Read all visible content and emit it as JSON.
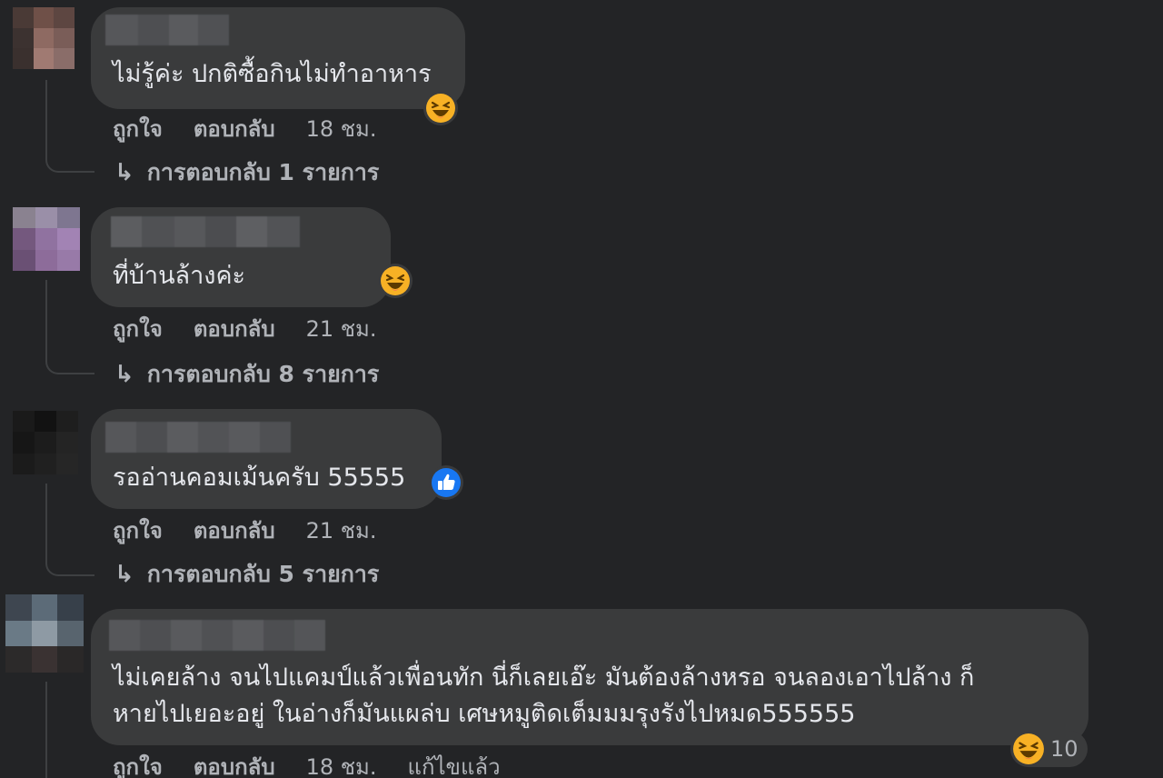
{
  "comments": [
    {
      "text_lines": [
        "ไม่รู้ค่ะ ปกติซื้อกินไม่ทำอาหาร"
      ],
      "reaction": "haha",
      "actions": {
        "like": "ถูกใจ",
        "reply": "ตอบกลับ",
        "time": "18 ชม."
      },
      "replies_label": "การตอบกลับ 1 รายการ"
    },
    {
      "text_lines": [
        "ที่บ้านล้างค่ะ"
      ],
      "reaction": "haha",
      "actions": {
        "like": "ถูกใจ",
        "reply": "ตอบกลับ",
        "time": "21 ชม."
      },
      "replies_label": "การตอบกลับ 8 รายการ"
    },
    {
      "text_lines": [
        "รออ่านคอมเม้นครับ 55555"
      ],
      "reaction": "like",
      "actions": {
        "like": "ถูกใจ",
        "reply": "ตอบกลับ",
        "time": "21 ชม."
      },
      "replies_label": "การตอบกลับ 5 รายการ"
    },
    {
      "text_lines": [
        "ไม่เคยล้าง จนไปแคมป์แล้วเพื่อนทัก นี่ก็เลยเอ๊ะ มันต้องล้างหรอ จนลองเอาไปล้าง ก็",
        "หายไปเยอะอยู่ ในอ่างก็มันแผล่บ เศษหมูติดเต็มมมรุงรังไปหมด555555"
      ],
      "reaction": "haha",
      "reaction_count": "10",
      "actions": {
        "like": "ถูกใจ",
        "reply": "ตอบกลับ",
        "time": "18 ชม.",
        "edited": "แก้ไขแล้ว"
      }
    }
  ],
  "colors": {
    "background": "#232426",
    "bubble": "#3a3b3c",
    "text": "#e4e6eb",
    "secondary_text": "#b0b3b8",
    "like_blue": "#1877f2",
    "haha_yellow": "#f7b125"
  },
  "icons": {
    "haha": "laughing-face-icon",
    "like": "thumbs-up-icon",
    "reply_arrow": "reply-arrow-icon"
  }
}
